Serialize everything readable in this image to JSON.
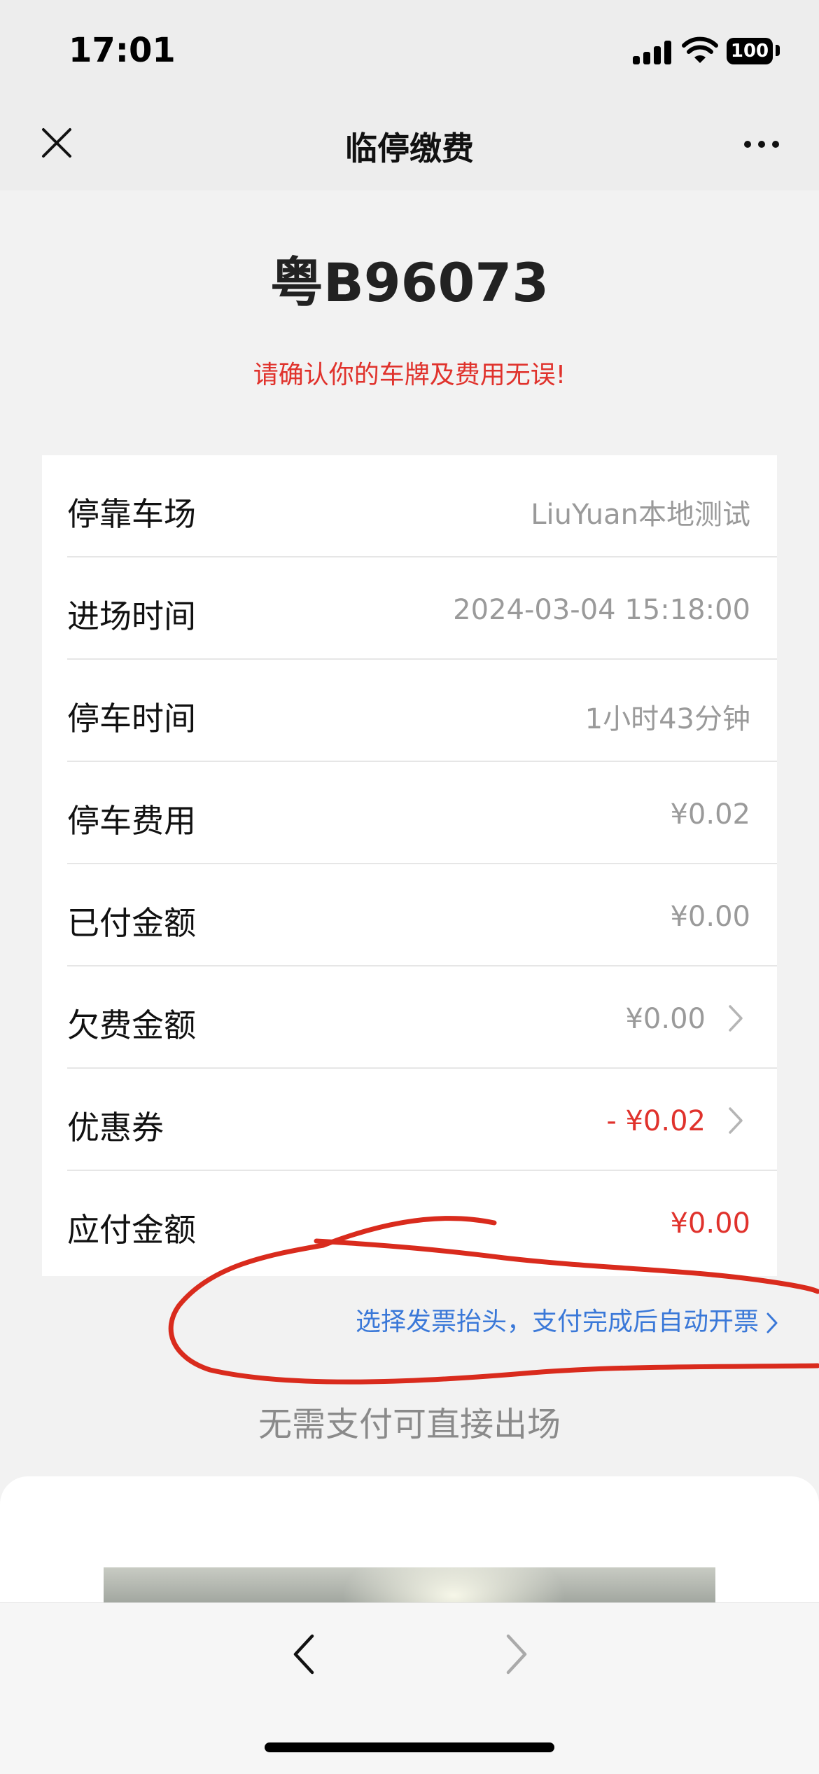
{
  "status_bar": {
    "time": "17:01",
    "battery": "100"
  },
  "nav": {
    "title": "临停缴费"
  },
  "plate": "粤B96073",
  "warning": "请确认你的车牌及费用无误!",
  "rows": [
    {
      "label": "停靠车场",
      "value": "LiuYuan本地测试"
    },
    {
      "label": "进场时间",
      "value": "2024-03-04 15:18:00"
    },
    {
      "label": "停车时间",
      "value": "1小时43分钟"
    },
    {
      "label": "停车费用",
      "value": "¥0.02"
    },
    {
      "label": "已付金额",
      "value": "¥0.00"
    },
    {
      "label": "欠费金额",
      "value": "¥0.00"
    },
    {
      "label": "优惠券",
      "value": "- ¥0.02"
    },
    {
      "label": "应付金额",
      "value": "¥0.00"
    }
  ],
  "invoice_link": "选择发票抬头，支付完成后自动开票",
  "no_pay_text": "无需支付可直接出场",
  "colors": {
    "accent_red": "#e0322c",
    "link_blue": "#3a78d8",
    "annotation_red": "#d92b1d"
  }
}
